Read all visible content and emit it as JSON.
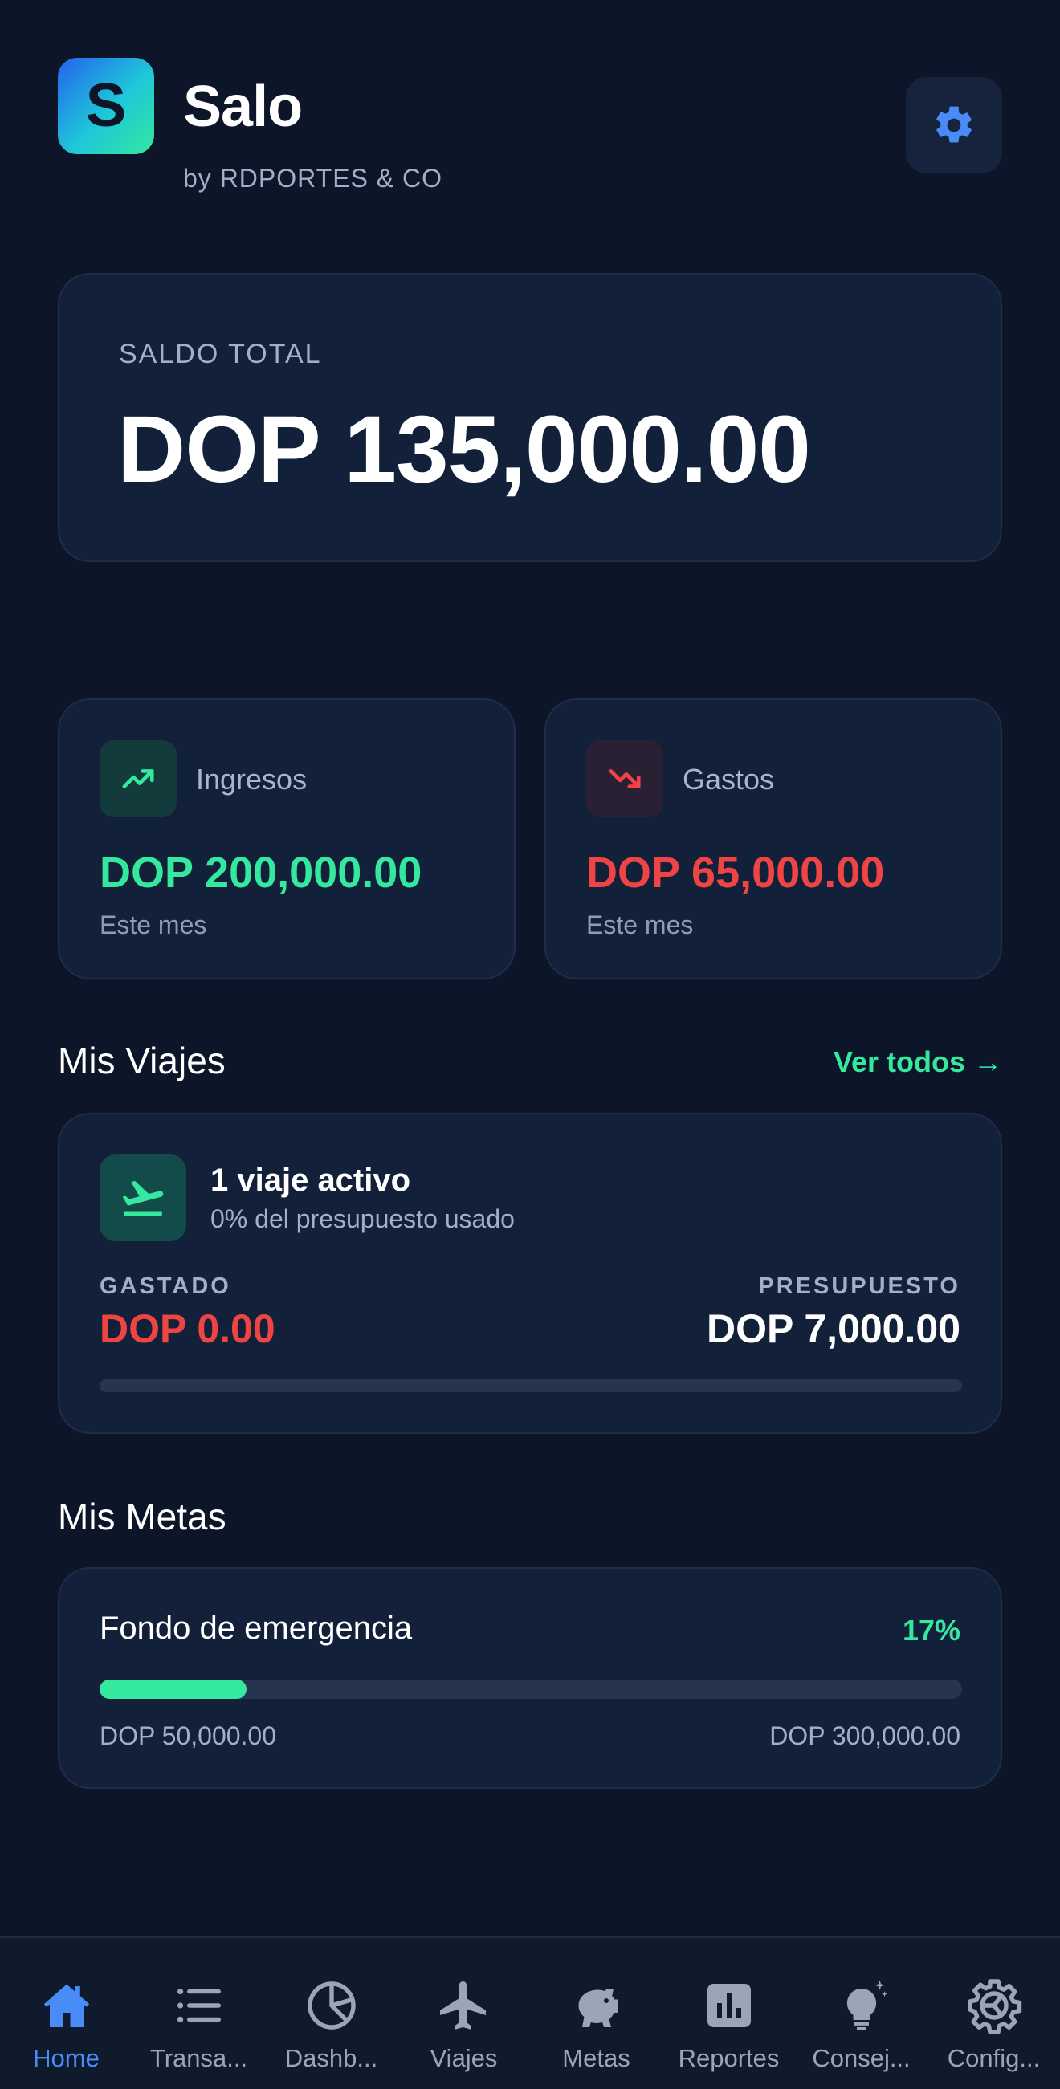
{
  "header": {
    "logo_letter": "S",
    "app_name": "Salo",
    "subtitle": "by RDPORTES & CO",
    "settings_icon": "gear-icon"
  },
  "balance": {
    "label": "SALDO TOTAL",
    "value": "DOP 135,000.00"
  },
  "income": {
    "title": "Ingresos",
    "value": "DOP 200,000.00",
    "period": "Este mes",
    "icon": "trending-up-icon",
    "color": "#34e89e"
  },
  "expenses": {
    "title": "Gastos",
    "value": "DOP 65,000.00",
    "period": "Este mes",
    "icon": "trending-down-icon",
    "color": "#ef4444"
  },
  "trips": {
    "section_title": "Mis Viajes",
    "see_all": "Ver todos →",
    "card": {
      "title": "1 viaje activo",
      "subtitle": "0% del presupuesto usado",
      "spent_label": "GASTADO",
      "spent_value": "DOP 0.00",
      "budget_label": "PRESUPUESTO",
      "budget_value": "DOP 7,000.00",
      "progress": 0,
      "icon": "plane-departure-icon"
    }
  },
  "goals": {
    "section_title": "Mis Metas",
    "items": [
      {
        "name": "Fondo de emergencia",
        "percent_label": "17%",
        "progress": 0.17,
        "current": "DOP 50,000.00",
        "target": "DOP 300,000.00"
      }
    ]
  },
  "nav": {
    "active_color": "#4a8cf7",
    "items": [
      {
        "label": "Home",
        "icon": "home-icon",
        "active": true
      },
      {
        "label": "Transa...",
        "icon": "list-icon",
        "active": false
      },
      {
        "label": "Dashb...",
        "icon": "pie-chart-icon",
        "active": false
      },
      {
        "label": "Viajes",
        "icon": "airplane-icon",
        "active": false
      },
      {
        "label": "Metas",
        "icon": "piggy-bank-icon",
        "active": false
      },
      {
        "label": "Reportes",
        "icon": "bar-chart-icon",
        "active": false
      },
      {
        "label": "Consej...",
        "icon": "lightbulb-icon",
        "active": false
      },
      {
        "label": "Config...",
        "icon": "settings-icon",
        "active": false
      }
    ]
  }
}
